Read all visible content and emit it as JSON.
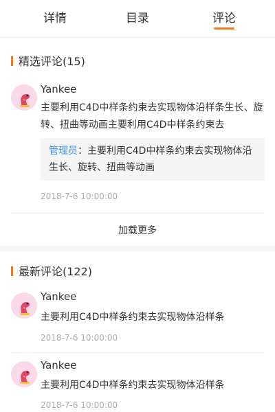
{
  "tabs": [
    "详情",
    "目录",
    "评论"
  ],
  "active_tab_index": 2,
  "colors": {
    "accent": "#f37b1d",
    "admin_name": "#3a8ee6",
    "time": "#aaaaaa"
  },
  "featured": {
    "title": "精选评论(15)",
    "comments": [
      {
        "username": "Yankee",
        "content": "主要利用C4D中样条约束去实现物体沿样条生长、旋转、扭曲等动画主要利用C4D中样条约束去",
        "reply_name": "管理员",
        "reply_sep": "：",
        "reply_text": "主要利用C4D中样条约束去实现物体沿生长、旋转、扭曲等动画",
        "time": "2018-7-6 10:00:00"
      }
    ],
    "load_more": "加载更多"
  },
  "latest": {
    "title": "最新评论(122)",
    "comments": [
      {
        "username": "Yankee",
        "content": "主要利用C4D中样条约束去实现物体沿样条",
        "time": "2018-7-6 10:00:00"
      },
      {
        "username": "Yankee",
        "content": "主要利用C4D中样条约束去实现物体沿样条",
        "time": "2018-7-6 10:00:00"
      }
    ]
  },
  "icons": {
    "avatar": "pink-dinosaur-avatar-icon"
  }
}
